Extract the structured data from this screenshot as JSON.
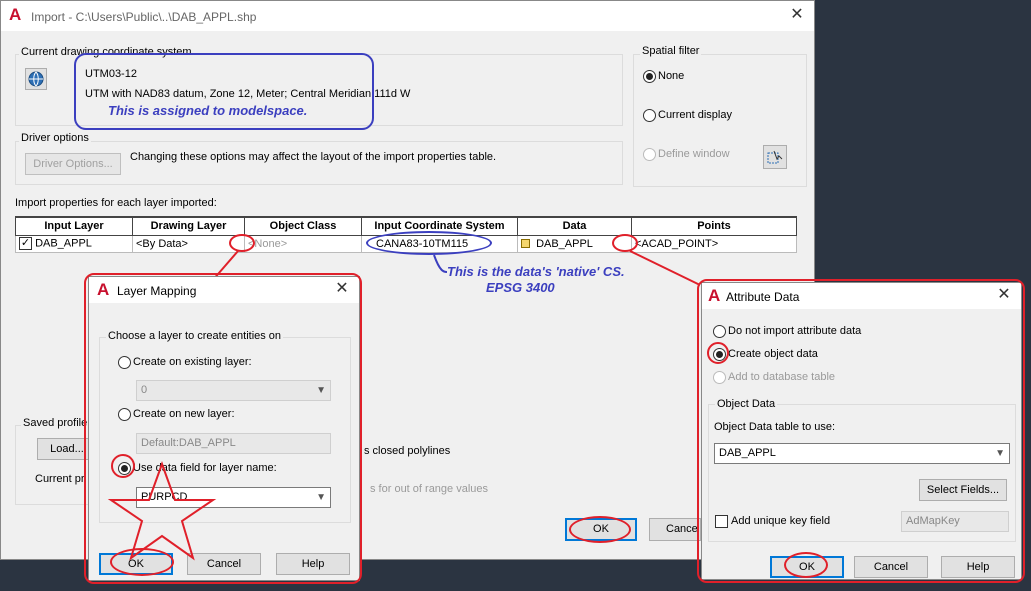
{
  "import_dialog": {
    "title": "Import - C:\\Users\\Public\\..\\DAB_APPL.shp",
    "coord_group_label": "Current drawing coordinate system",
    "cs_code": "UTM03-12",
    "cs_description": "UTM with NAD83 datum, Zone 12, Meter; Central Meridian 111d W",
    "driver_group_label": "Driver options",
    "driver_button": "Driver Options...",
    "driver_note": "Changing these options may affect the layout of the import properties table.",
    "spatial_filter_label": "Spatial filter",
    "spatial_options": [
      "None",
      "Current display",
      "Define window"
    ],
    "import_props_label": "Import properties for each layer imported:",
    "table_headers": [
      "Input Layer",
      "Drawing Layer",
      "Object Class",
      "Input Coordinate System",
      "Data",
      "Points"
    ],
    "row": {
      "input_layer": "DAB_APPL",
      "drawing_layer": "<By Data>",
      "object_class": "<None>",
      "coord_system": "CANA83-10TM115",
      "data": "DAB_APPL",
      "points": "<ACAD_POINT>"
    },
    "saved_profile_label": "Saved profile",
    "load_button": "Load...",
    "current_profile_label": "Current pr",
    "closed_polylines_text": "s closed polylines",
    "out_of_range_text": "s for out of range values",
    "ok_button": "OK",
    "cancel_button": "Cance"
  },
  "layer_mapping_dialog": {
    "title": "Layer Mapping",
    "group_label": "Choose a layer to create entities on",
    "opt_existing": "Create on existing layer:",
    "existing_value": "0",
    "opt_new": "Create on new layer:",
    "new_value": "Default:DAB_APPL",
    "opt_field": "Use data field for layer name:",
    "field_value": "PURPCD",
    "ok_button": "OK",
    "cancel_button": "Cancel",
    "help_button": "Help"
  },
  "attribute_dialog": {
    "title": "Attribute Data",
    "opt_none": "Do not import attribute data",
    "opt_object": "Create object data",
    "opt_db": "Add to database table",
    "group_label": "Object Data",
    "table_label": "Object Data table to use:",
    "table_value": "DAB_APPL",
    "select_fields_button": "Select Fields...",
    "unique_key_label": "Add unique key field",
    "key_value": "AdMapKey",
    "ok_button": "OK",
    "cancel_button": "Cancel",
    "help_button": "Help"
  },
  "annotations": {
    "modelspace": "This is assigned to modelspace.",
    "native_line1": "This is the data's 'native' CS.",
    "native_line2": "EPSG 3400"
  },
  "colors": {
    "annotation_blue": "#3b3fbf",
    "annotation_red": "#e0202a",
    "autocad_red": "#c8102e"
  }
}
